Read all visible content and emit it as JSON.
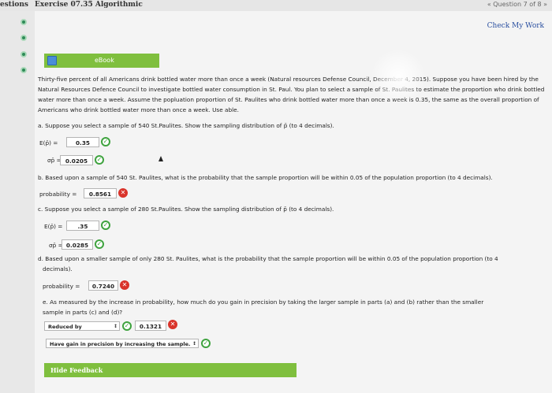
{
  "topbar": {
    "left_label": "estions",
    "title": "Exercise 07.35 Algorithmic",
    "question_nav": "« Question 7 of 8 »"
  },
  "check_work": "Check My Work",
  "ebook_label": "eBook",
  "problem_text": "Thirty-five percent of all Americans drink bottled water more than once a week (Natural resources Defense Council, December 4, 2015). Suppose you have been hired by the Natural Resources Defence Council to investigate bottled water consumption in St. Paul. You plan to select a sample of St. Paulites to estimate the proportion who drink bottled water more than once a week. Assume the popluation proportion of St. Paulites who drink bottled water more than once a week is 0.35, the same as the overall proportion of Americans who drink bottled water more than once a week. Use   able.",
  "part_a": {
    "prompt": "a. Suppose you select a sample of 540 St.Paulites. Show the sampling distribution of p̄ (to 4 decimals).",
    "ep_label": "E(p̄) =",
    "ep_value": "0.35",
    "sigma_label": "σp̄ =",
    "sigma_value": "0.0205"
  },
  "part_b": {
    "prompt": "b. Based upon a sample of 540 St. Paulites, what is the probability that the sample proportion will be within 0.05 of the population proportion (to 4 decimals).",
    "prob_label": "probability =",
    "prob_value": "0.8561"
  },
  "part_c": {
    "prompt": "c. Suppose you select a sample of 280 St.Paulites. Show the sampling distribution of p̄ (to 4 decimals).",
    "ep_label": "E(p̄) =",
    "ep_value": ".35",
    "sigma_label": "σp̄ =",
    "sigma_value": "0.0285"
  },
  "part_d": {
    "prompt_line1": "d. Based upon a smaller sample of only 280 St. Paulites, what is the probability that the sample proportion will be within 0.05 of the population proportion (to 4",
    "prompt_line2": "decimals).",
    "prob_label": "probability =",
    "prob_value": "0.7240"
  },
  "part_e": {
    "prompt_line1": "e. As measured by the increase in probability, how much do you gain in precision by taking the larger sample in parts (a) and (b) rather than the smaller",
    "prompt_line2": "sample in parts (c) and (d)?",
    "select1_value": "Reduced by",
    "select1_arrow": "↕",
    "amount_value": "0.1321",
    "select2_value": "Have gain in precision by increasing the sample.",
    "select2_arrow": "↕"
  },
  "hide_feedback": "Hide Feedback",
  "status": {
    "check": "✓",
    "cross": "✕"
  }
}
